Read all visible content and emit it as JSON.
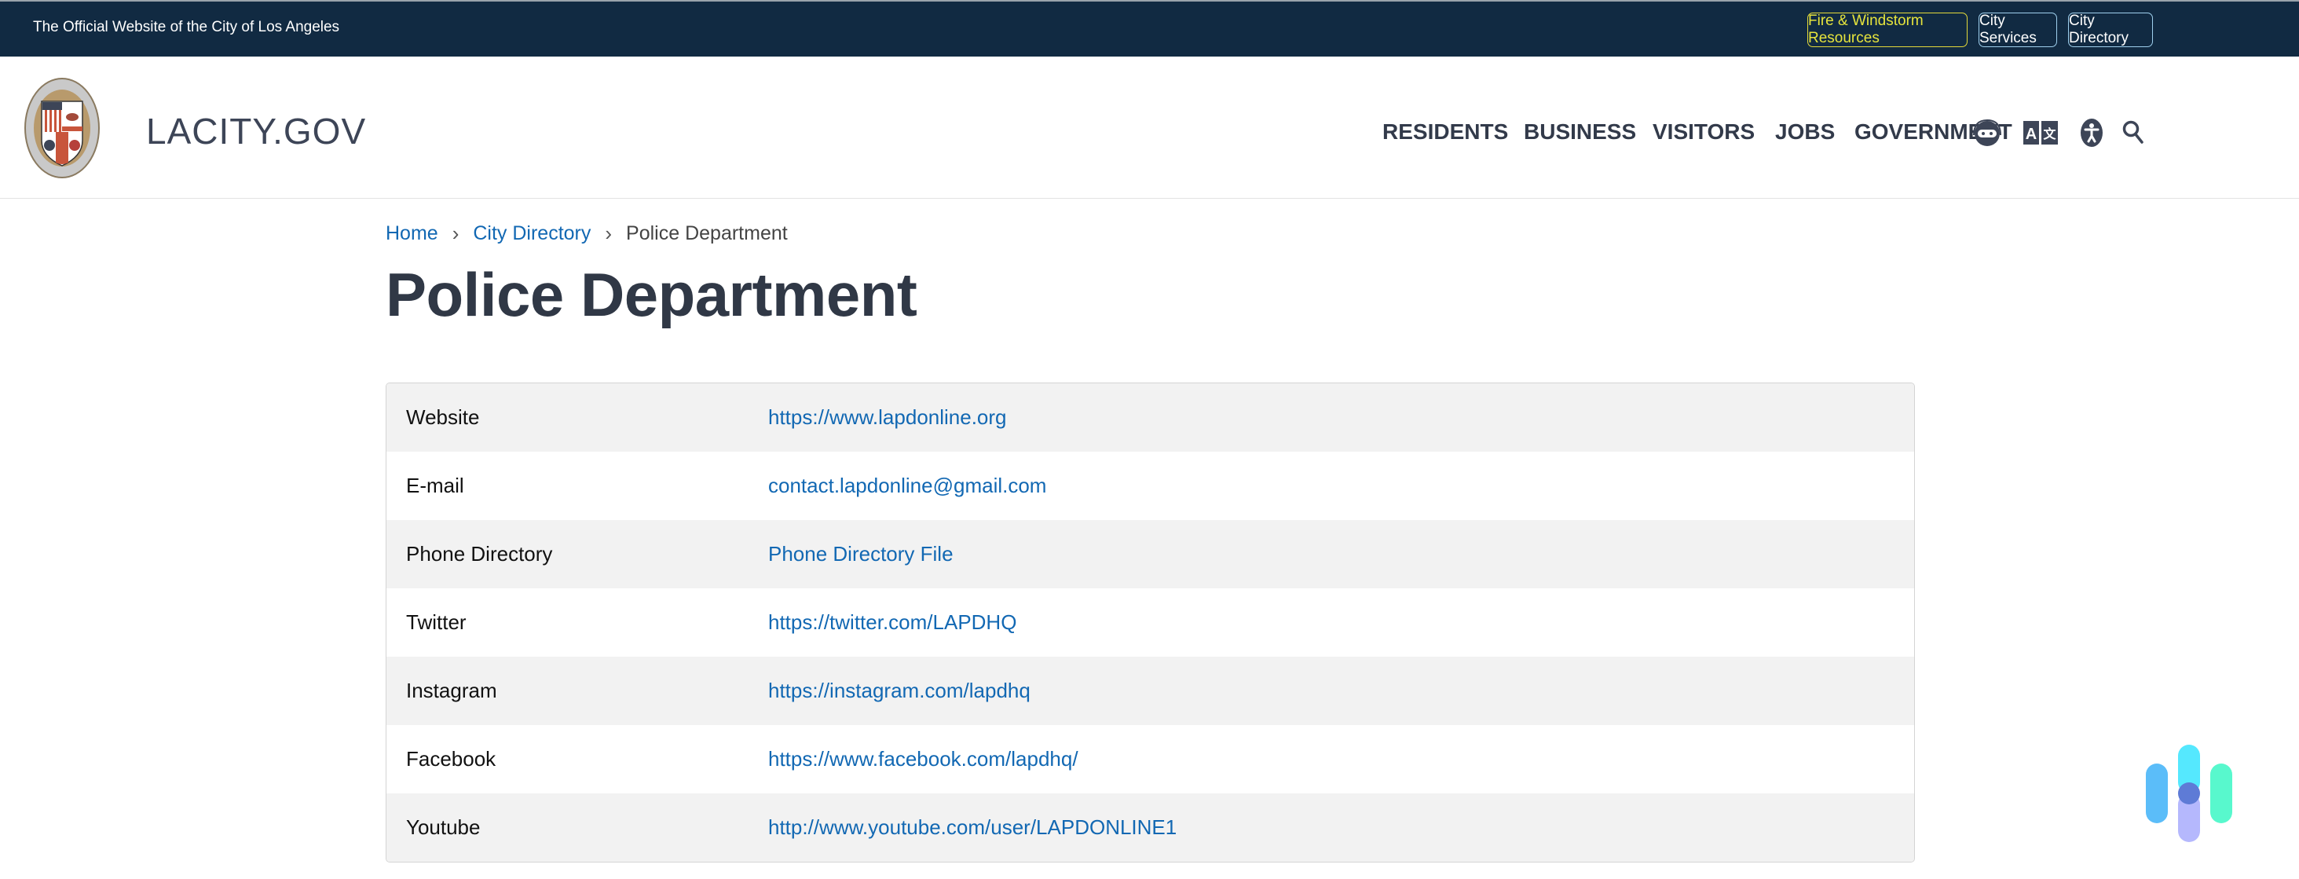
{
  "topbar": {
    "official_text": "The Official Website of the City of Los Angeles",
    "buttons": [
      {
        "label": "Fire & Windstorm Resources",
        "color": "#e6e43c"
      },
      {
        "label": "City Services"
      },
      {
        "label": "City Directory"
      }
    ]
  },
  "header": {
    "logo_seal_text": "CITY OF LOS ANGELES FOUNDED 1781",
    "brand": "LACITY.GOV",
    "nav": [
      "RESIDENTS",
      "BUSINESS",
      "VISITORS",
      "JOBS",
      "GOVERNMENT"
    ],
    "icons": [
      "chatbot-icon",
      "translate-icon",
      "accessibility-icon",
      "search-icon"
    ]
  },
  "breadcrumb": {
    "items": [
      "Home",
      "City Directory",
      "Police Department"
    ]
  },
  "page_title": "Police Department",
  "table": {
    "rows": [
      {
        "label": "Website",
        "value": "https://www.lapdonline.org"
      },
      {
        "label": "E-mail",
        "value": "contact.lapdonline@gmail.com"
      },
      {
        "label": "Phone Directory",
        "value": "Phone Directory File"
      },
      {
        "label": "Twitter",
        "value": "https://twitter.com/LAPDHQ"
      },
      {
        "label": "Instagram",
        "value": "https://instagram.com/lapdhq"
      },
      {
        "label": "Facebook",
        "value": "https://www.facebook.com/lapdhq/"
      },
      {
        "label": "Youtube",
        "value": "http://www.youtube.com/user/LAPDONLINE1"
      }
    ]
  },
  "colors": {
    "topbar": "#112a42",
    "link": "#1268b3",
    "heading": "#303846"
  }
}
